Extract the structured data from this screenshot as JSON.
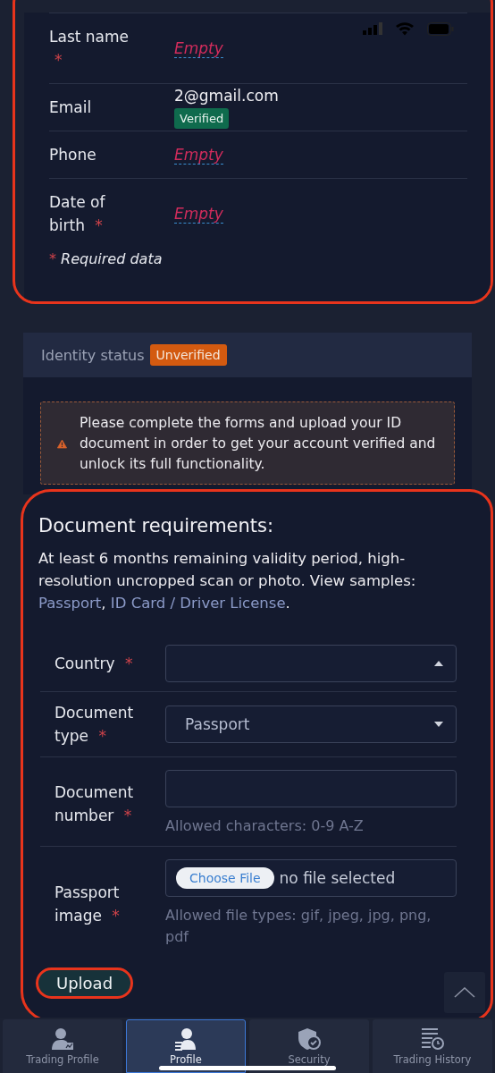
{
  "required_mark": "*",
  "contact_fields": [
    {
      "label": "Last name",
      "required": true,
      "value": "Empty",
      "empty": true
    },
    {
      "label": "Email",
      "required": false,
      "value": "2@gmail.com",
      "empty": false,
      "badge": "Verified"
    },
    {
      "label": "Phone",
      "required": false,
      "value": "Empty",
      "empty": true
    },
    {
      "label": "Date of birth",
      "required": true,
      "value": "Empty",
      "empty": true
    }
  ],
  "required_note": "Required data",
  "identity": {
    "label": "Identity status",
    "badge": "Unverified"
  },
  "warning": "Please complete the forms and upload your ID document in order to get your account verified and unlock its full functionality.",
  "requirements": {
    "title": "Document requirements:",
    "text": "At least 6 months remaining validity period, high-resolution uncropped scan or photo. View samples:",
    "links": [
      {
        "label": "Passport",
        "after": ","
      },
      {
        "label": "ID Card / Driver License",
        "after": "."
      }
    ]
  },
  "form_fields": [
    {
      "kind": "select",
      "label": "Country",
      "required": true,
      "expanded": true
    },
    {
      "kind": "select",
      "label": "Document type",
      "required": true,
      "value": "Passport",
      "expanded": false
    },
    {
      "kind": "text",
      "label": "Document number",
      "required": true,
      "hint": "Allowed characters: 0-9 A-Z"
    },
    {
      "kind": "file",
      "label": "Passport image",
      "required": true,
      "button": "Choose File",
      "value": "no file selected",
      "hint": "Allowed file types: gif, jpeg, jpg, png, pdf"
    }
  ],
  "upload_button": "Upload",
  "tabs": [
    {
      "label": "Trading Profile",
      "selected": false
    },
    {
      "label": "Profile",
      "selected": true
    },
    {
      "label": "Security",
      "selected": false
    },
    {
      "label": "Trading History",
      "selected": false
    }
  ]
}
